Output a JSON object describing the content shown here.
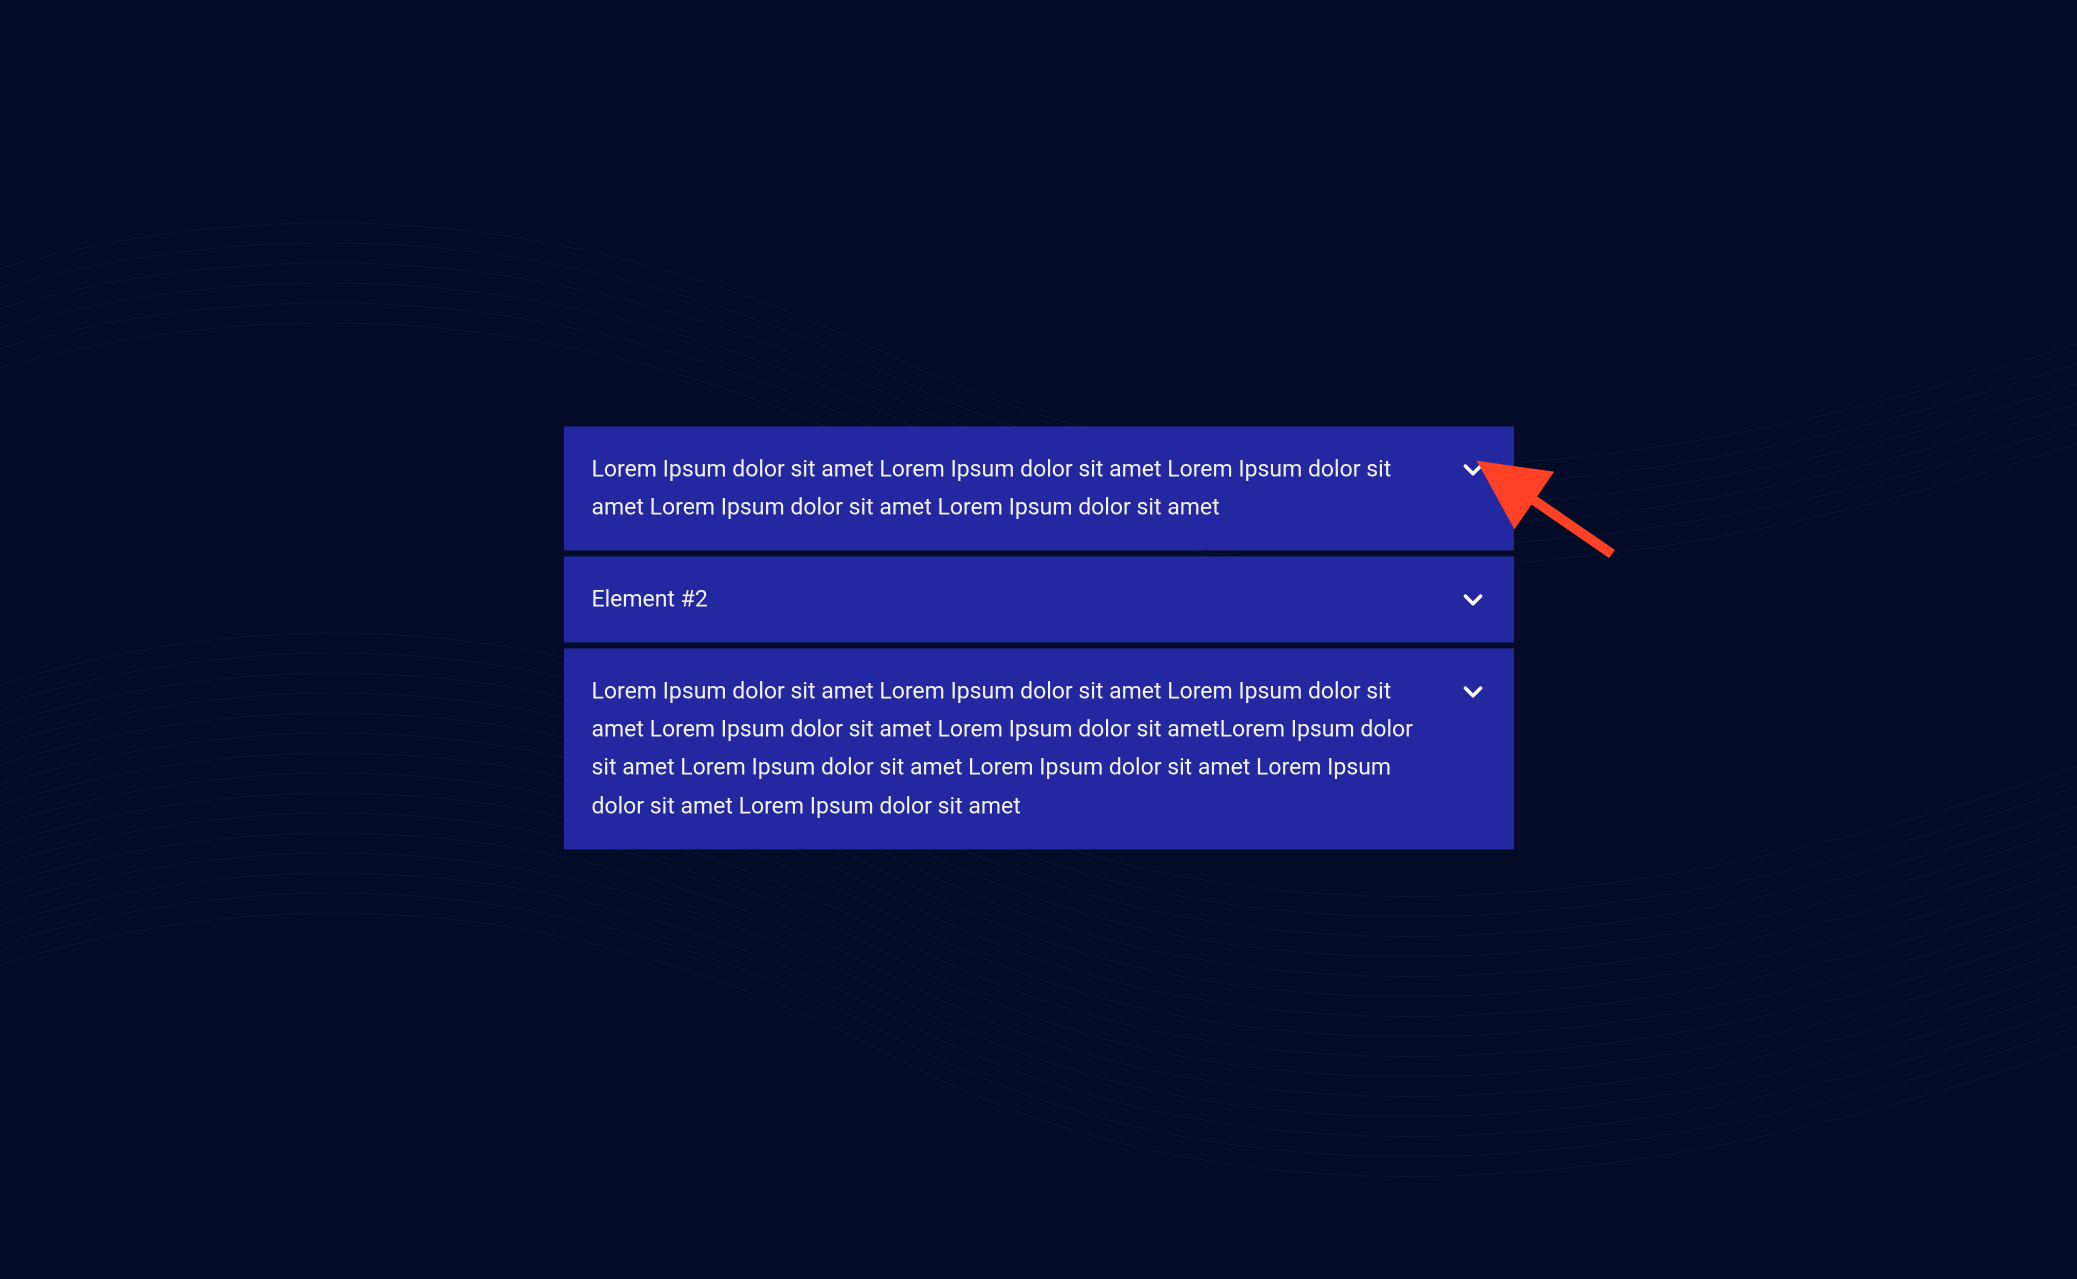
{
  "accordion": {
    "items": [
      {
        "label": "Lorem Ipsum dolor sit amet Lorem Ipsum dolor sit amet Lorem Ipsum dolor sit amet Lorem Ipsum dolor sit amet Lorem Ipsum dolor sit amet"
      },
      {
        "label": "Element #2"
      },
      {
        "label": "Lorem Ipsum dolor sit amet Lorem Ipsum dolor sit amet Lorem Ipsum dolor sit amet Lorem Ipsum dolor sit amet Lorem Ipsum dolor sit ametLorem Ipsum dolor sit amet Lorem Ipsum dolor sit amet Lorem Ipsum dolor sit amet Lorem Ipsum dolor sit amet Lorem Ipsum dolor sit amet"
      }
    ]
  },
  "colors": {
    "background": "#040b26",
    "panel": "#2428a0",
    "text": "#f2f2f7",
    "arrow": "#ff4126"
  }
}
